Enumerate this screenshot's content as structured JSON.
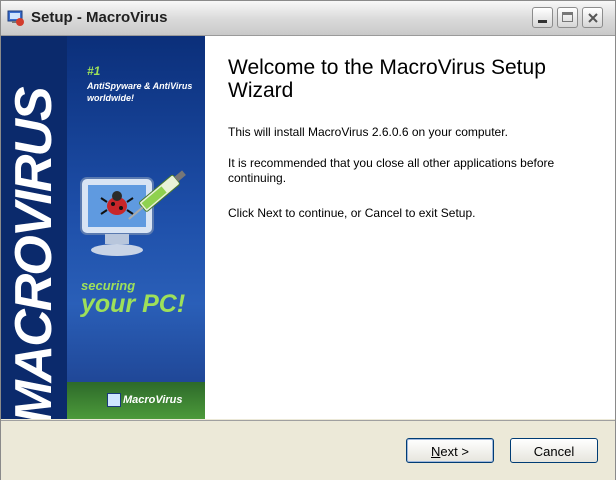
{
  "window": {
    "title": "Setup - MacroVirus"
  },
  "banner": {
    "brand_vertical": "MACROVIRUS",
    "rank": "#1",
    "rank_desc": "AntiSpyware & AntiVirus worldwide!",
    "slogan_line1": "securing",
    "slogan_line2": "your PC!",
    "footer_logo": "MacroVirus"
  },
  "main": {
    "heading": "Welcome to the MacroVirus Setup Wizard",
    "paragraphs": [
      "This will install MacroVirus 2.6.0.6 on your computer.",
      "It is recommended that you close all other applications before continuing.",
      "Click Next to continue, or Cancel to exit Setup."
    ]
  },
  "buttons": {
    "next_mnemonic": "N",
    "next_rest": "ext >",
    "cancel": "Cancel"
  },
  "icons": {
    "title": "setup-app-icon",
    "minimize": "minimize-icon",
    "maximize": "maximize-icon",
    "close": "close-icon",
    "monitor": "monitor-bug-syringe-illustration"
  },
  "colors": {
    "banner_dark": "#0b2a6c",
    "banner_mid": "#1d4ea8",
    "accent_green": "#9ee05a",
    "button_border": "#003c74"
  }
}
